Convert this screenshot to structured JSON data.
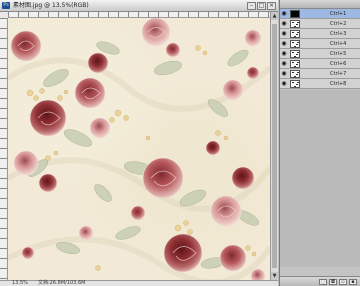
{
  "document": {
    "title": "素材图.jpg @ 13.5%(RGB)",
    "window_buttons": {
      "minimize": "–",
      "maximize": "□",
      "close": "×"
    }
  },
  "status_bar": {
    "zoom": "13.5%",
    "doc_info": "文档:26.8M/103.6M"
  },
  "channels_panel": {
    "rows": [
      {
        "shortcut": "Ctrl+1",
        "thumb": "black",
        "visible": true,
        "selected": true
      },
      {
        "shortcut": "Ctrl+2",
        "thumb": "white",
        "visible": true,
        "selected": false
      },
      {
        "shortcut": "Ctrl+3",
        "thumb": "white",
        "visible": true,
        "selected": false
      },
      {
        "shortcut": "Ctrl+4",
        "thumb": "white",
        "visible": true,
        "selected": false
      },
      {
        "shortcut": "Ctrl+5",
        "thumb": "white",
        "visible": true,
        "selected": false
      },
      {
        "shortcut": "Ctrl+6",
        "thumb": "white",
        "visible": true,
        "selected": false
      },
      {
        "shortcut": "Ctrl+7",
        "thumb": "white",
        "visible": true,
        "selected": false
      },
      {
        "shortcut": "Ctrl+8",
        "thumb": "white",
        "visible": true,
        "selected": false
      }
    ],
    "icons": {
      "eye": "eye-icon"
    }
  },
  "colors": {
    "canvas_bg": "#f2ead6",
    "rose_dark": "#8e2f33",
    "rose_mid": "#b5575a",
    "rose_light": "#d99a99",
    "leaf": "#c9cfb4",
    "bud": "#e9d39a",
    "selection": "#9db8e3"
  }
}
